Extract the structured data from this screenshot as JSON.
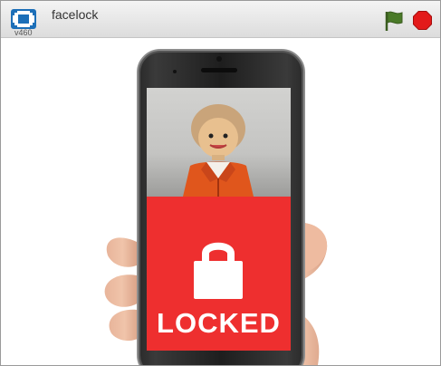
{
  "window": {
    "version": "v460",
    "project_title": "facelock"
  },
  "toolbar": {
    "fullscreen_icon": "fullscreen-icon",
    "green_flag_icon": "green-flag-icon",
    "stop_icon": "stop-icon",
    "flag_color": "#4a7a28",
    "stop_color": "#e31a1a"
  },
  "stage": {
    "status_text": "LOCKED",
    "panel_color": "#ee2f2f",
    "lock_icon": "padlock-icon"
  }
}
